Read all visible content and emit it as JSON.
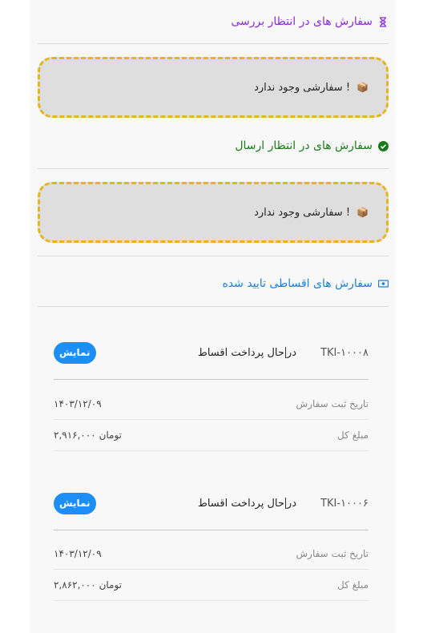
{
  "sections": {
    "pending_review": {
      "title": "سفارش های در انتظار بررسی",
      "color": "#8a2be2"
    },
    "pending_send": {
      "title": "سفارش های در انتظار ارسال",
      "color": "#1a7a1a"
    },
    "installment_approved": {
      "title": "سفارش های اقساطی تایید شده",
      "color": "#1e7fd6"
    }
  },
  "empty_message": "سفارشی وجود ندارد !",
  "orders": [
    {
      "order_no": "TKI-۱۰۰۰۸",
      "status_pre": "در",
      "status_post": "حال پرداخت اقساط",
      "button": "نمایش",
      "date_label": "تاریخ ثبت سفارش",
      "date_value": "۱۴۰۳/۱۲/۰۹",
      "total_label": "مبلغ کل",
      "total_value": "۲,۹۱۶,۰۰۰ تومان"
    },
    {
      "order_no": "TKI-۱۰۰۰۶",
      "status_pre": "در",
      "status_post": "حال پرداخت اقساط",
      "button": "نمایش",
      "date_label": "تاریخ ثبت سفارش",
      "date_value": "۱۴۰۳/۱۲/۰۹",
      "total_label": "مبلغ کل",
      "total_value": "۲,۸۶۲,۰۰۰ تومان"
    }
  ]
}
